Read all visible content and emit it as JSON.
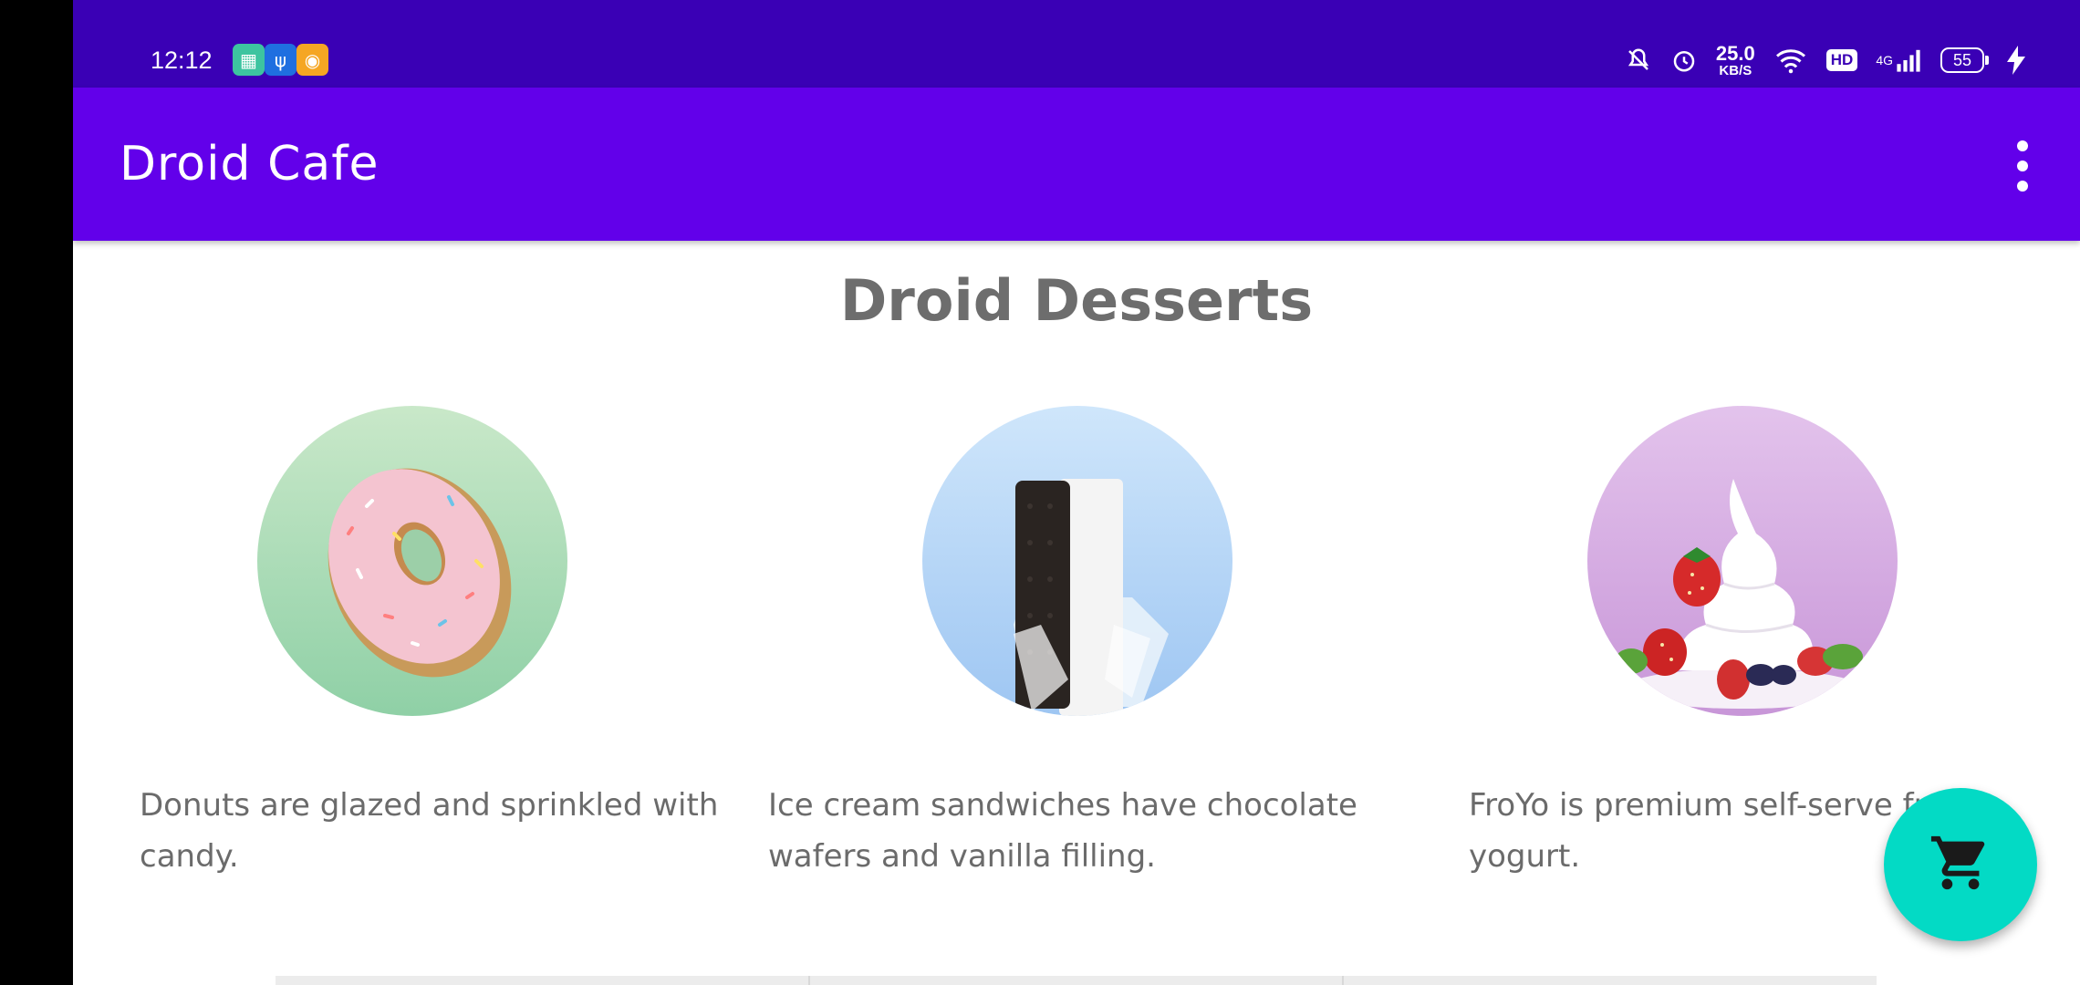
{
  "status_bar": {
    "time": "12:12",
    "net_speed_value": "25.0",
    "net_speed_unit": "KB/S",
    "hd_label": "HD",
    "network_label": "4G",
    "battery_level": "55"
  },
  "app_bar": {
    "title": "Droid Cafe"
  },
  "main": {
    "heading": "Droid Desserts",
    "desserts": [
      {
        "icon": "donut-image",
        "description": "Donuts are glazed and sprinkled with candy."
      },
      {
        "icon": "ice-cream-sandwich-image",
        "description": "Ice cream sandwiches have chocolate wafers and vanilla filling."
      },
      {
        "icon": "froyo-image",
        "description": "FroYo is premium self-serve frozen yogurt."
      }
    ]
  },
  "colors": {
    "status_bar": "#3a00b5",
    "app_bar": "#6200ea",
    "fab": "#03dac5",
    "text": "#6b6b6b"
  }
}
